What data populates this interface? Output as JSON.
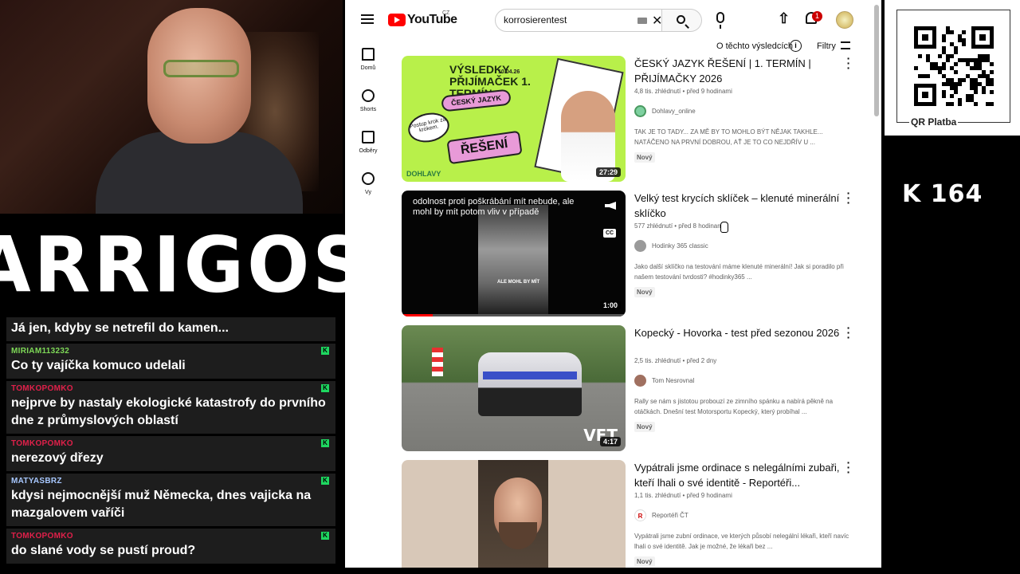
{
  "stream": {
    "logo_text": "ARRIGOS",
    "counter": "K 164",
    "qr_label": "QR Platba"
  },
  "chat": [
    {
      "user": "",
      "user_color": "",
      "text": "Já jen, kdyby se netrefil do kamen...",
      "badge": false
    },
    {
      "user": "MIRIAM113232",
      "user_color": "#7ed957",
      "text": "Co ty vajíčka komuco udelali",
      "badge": true
    },
    {
      "user": "TOMKOPOMKO",
      "user_color": "#e0204a",
      "text": "nejprve by nastaly ekologické katastrofy do prvního dne z průmyslových oblastí",
      "badge": true
    },
    {
      "user": "TOMKOPOMKO",
      "user_color": "#e0204a",
      "text": "nerezový dřezy",
      "badge": true
    },
    {
      "user": "MATYASBRZ",
      "user_color": "#a8c8ff",
      "text": "kdysi nejmocnější muž Německa, dnes vajicka na mazgalovem vaříči",
      "badge": true
    },
    {
      "user": "TOMKOPOMKO",
      "user_color": "#e0204a",
      "text": "do slané vody se pustí proud?",
      "badge": true
    }
  ],
  "youtube": {
    "logo_word": "YouTube",
    "country": "CZ",
    "search_value": "korrosierentest",
    "about_results": "O těchto výsledcích",
    "filters": "Filtry",
    "notification_count": "1",
    "nav": [
      {
        "label": "Domů",
        "icon": "home-icon"
      },
      {
        "label": "Shorts",
        "icon": "shorts-icon"
      },
      {
        "label": "Odběry",
        "icon": "subscriptions-icon"
      },
      {
        "label": "Vy",
        "icon": "account-icon"
      }
    ],
    "results": [
      {
        "title": "ČESKÝ JAZYK ŘEŠENÍ | 1. TERMÍN | PŘIJÍMAČKY 2026",
        "stats": "4,8 tis. zhlédnutí • před 9 hodinami",
        "channel": "Dohlavy_online",
        "channel_color": "#7ed0a0",
        "description": "TAK JE TO TADY... ZA MĚ BY TO MOHLO BÝT NĚJAK TAKHLE... NATÁČENO NA PRVNÍ DOBROU, AŤ JE TO CO NEJDŘÍV U ...",
        "badge": "Nový",
        "duration": "27:29",
        "thumb_text": {
          "headline": "VÝSLEDKY PŘIJÍMAČEK 1. TERMÍN",
          "date": "10.04.26",
          "pill1": "ČESKÝ JAZYK",
          "pill2": "ŘEŠENÍ",
          "bubble": "Postup krok za krokem.",
          "brand": "DOHLAVY"
        }
      },
      {
        "title": "Velký test krycích sklíček – klenuté minerální sklíčko",
        "stats": "577 zhlédnutí • před 8 hodinami",
        "channel": "Hodinky 365 classic",
        "channel_color": "#9a9a9a",
        "description": "Jako další sklíčko na testování máme klenuté minerální! Jak si poradilo při našem testování tvrdosti? #hodinky365 ...",
        "badge": "Nový",
        "duration": "1:00",
        "progress": 0.14,
        "thumb_text": {
          "caption": "odolnost proti poškrábání mít nebude, ale mohl by mít potom vliv v případě",
          "subtitle": "ALE MOHL BY MÍT",
          "cc": "CC"
        }
      },
      {
        "title": "Kopecký - Hovorka - test před sezonou 2026",
        "stats": "2,5 tis. zhlédnutí • před 2 dny",
        "channel": "Tom Nesrovnal",
        "channel_color": "#a07060",
        "description": "Rally se nám s jistotou probouzí ze zimního spánku a nabírá pěkně na otáčkách. Dnešní test Motorsportu Kopecký, který probíhal ...",
        "badge": "Nový",
        "duration": "4:17",
        "thumb_text": {
          "watermark": "VFT"
        }
      },
      {
        "title": "Vypátrali jsme ordinace s nelegálními zubaři, kteří lhali o své identitě - Reportéři...",
        "stats": "1,1 tis. zhlédnutí • před 9 hodinami",
        "channel": "Reportéři ČT",
        "channel_avatar_letter": "R",
        "channel_color": "#ffffff",
        "description": "Vypátrali jsme zubní ordinace, ve kterých působí nelegální lékaři, kteří navíc lhali o své identitě. Jak je možné, že lékaři bez ...",
        "badge": "Nový",
        "duration": ""
      }
    ]
  }
}
